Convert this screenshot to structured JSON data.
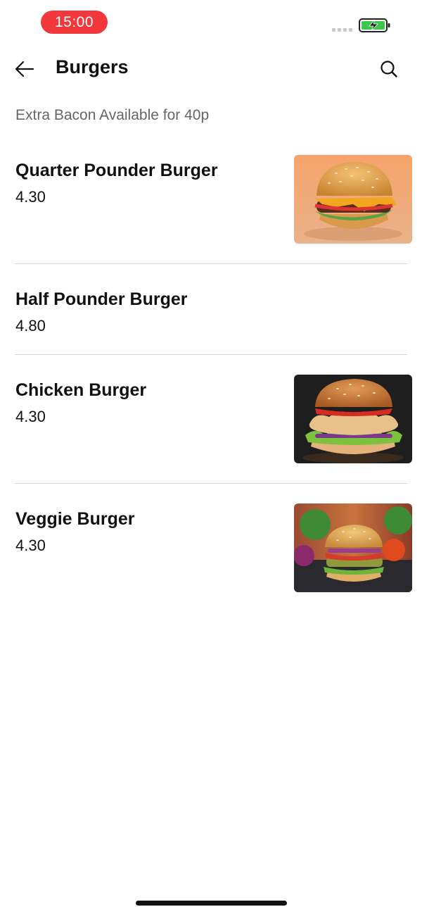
{
  "status_bar": {
    "time": "15:00",
    "time_pill_color": "#f2383b",
    "battery_icon": "battery-charging-icon",
    "signal_icon": "signal-dots-icon"
  },
  "header": {
    "title": "Burgers",
    "back_icon": "arrow-left-icon",
    "search_icon": "search-icon"
  },
  "subtitle": "Extra Bacon Available for 40p",
  "items": [
    {
      "name": "Quarter Pounder Burger",
      "price": "4.30",
      "has_image": true,
      "image": "cheeseburger-photo"
    },
    {
      "name": "Half Pounder Burger",
      "price": "4.80",
      "has_image": false
    },
    {
      "name": "Chicken Burger",
      "price": "4.30",
      "has_image": true,
      "image": "chicken-burger-photo"
    },
    {
      "name": "Veggie Burger",
      "price": "4.30",
      "has_image": true,
      "image": "veggie-burger-photo"
    }
  ]
}
